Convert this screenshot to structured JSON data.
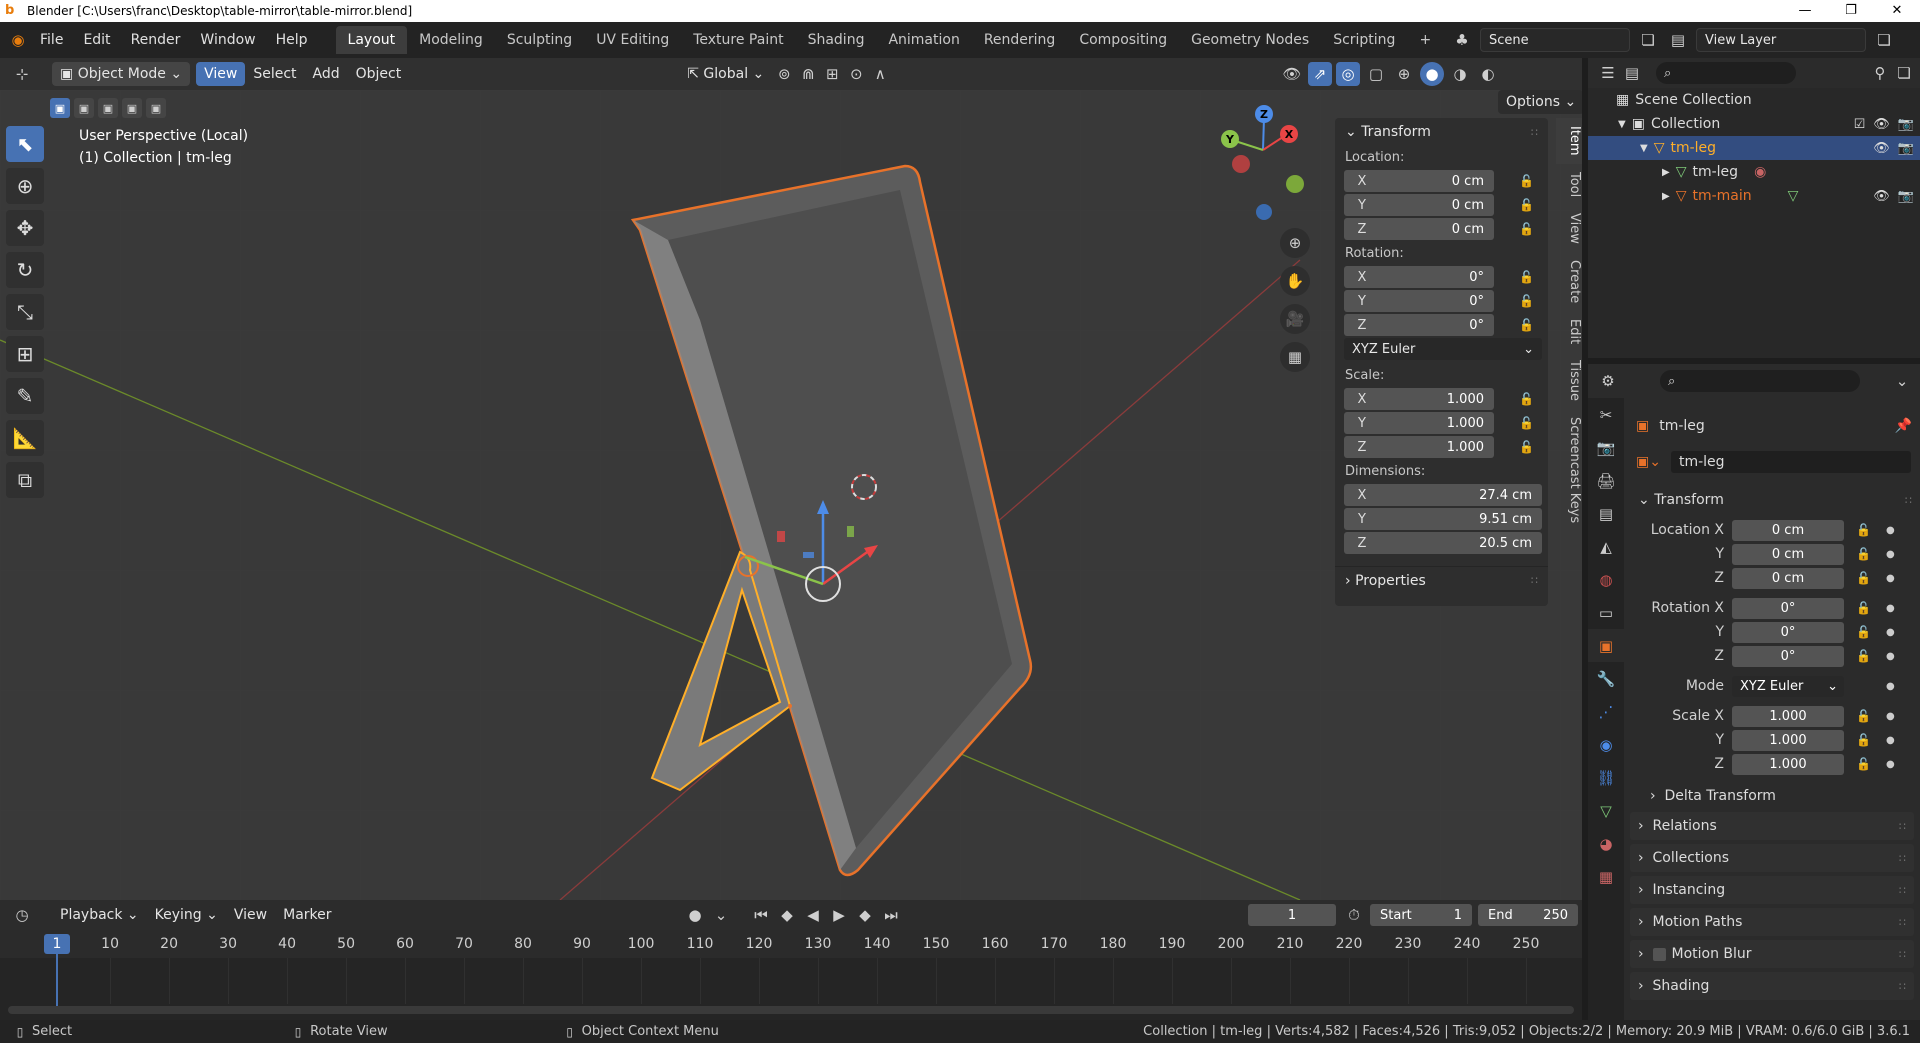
{
  "titlebar": {
    "title": "Blender [C:\\Users\\franc\\Desktop\\table-mirror\\table-mirror.blend]",
    "logo": "b",
    "minimize": "—",
    "maximize": "❐",
    "close": "✕"
  },
  "menu": [
    "File",
    "Edit",
    "Render",
    "Window",
    "Help"
  ],
  "workspaces": [
    "Layout",
    "Modeling",
    "Sculpting",
    "UV Editing",
    "Texture Paint",
    "Shading",
    "Animation",
    "Rendering",
    "Compositing",
    "Geometry Nodes",
    "Scripting"
  ],
  "active_workspace": "Layout",
  "add_workspace": "+",
  "scene": {
    "label": "Scene",
    "view_layer": "View Layer"
  },
  "viewport_header": {
    "mode": "Object Mode",
    "view": "View",
    "select": "Select",
    "add": "Add",
    "object": "Object",
    "orientation": "Global",
    "options": "Options"
  },
  "viewport": {
    "perspective": "User Perspective (Local)",
    "collection_info": "(1) Collection | tm-leg"
  },
  "gizmo": {
    "x": "X",
    "y": "Y",
    "z": "Z"
  },
  "npanel": {
    "transform_title": "Transform",
    "location_label": "Location:",
    "location": [
      {
        "axis": "X",
        "value": "0 cm"
      },
      {
        "axis": "Y",
        "value": "0 cm"
      },
      {
        "axis": "Z",
        "value": "0 cm"
      }
    ],
    "rotation_label": "Rotation:",
    "rotation": [
      {
        "axis": "X",
        "value": "0°"
      },
      {
        "axis": "Y",
        "value": "0°"
      },
      {
        "axis": "Z",
        "value": "0°"
      }
    ],
    "rotation_mode": "XYZ Euler",
    "scale_label": "Scale:",
    "scale": [
      {
        "axis": "X",
        "value": "1.000"
      },
      {
        "axis": "Y",
        "value": "1.000"
      },
      {
        "axis": "Z",
        "value": "1.000"
      }
    ],
    "dimensions_label": "Dimensions:",
    "dimensions": [
      {
        "axis": "X",
        "value": "27.4 cm"
      },
      {
        "axis": "Y",
        "value": "9.51 cm"
      },
      {
        "axis": "Z",
        "value": "20.5 cm"
      }
    ],
    "properties_title": "Properties"
  },
  "ntabs": [
    "Item",
    "Tool",
    "View",
    "Create",
    "Edit",
    "Tissue",
    "Screencast Keys"
  ],
  "timeline": {
    "playback": "Playback",
    "keying": "Keying",
    "view": "View",
    "marker": "Marker",
    "current_frame": "1",
    "start_label": "Start",
    "start": "1",
    "end_label": "End",
    "end": "250",
    "ticks": [
      "10",
      "20",
      "30",
      "40",
      "50",
      "60",
      "70",
      "80",
      "90",
      "100",
      "110",
      "120",
      "130",
      "140",
      "150",
      "160",
      "170",
      "180",
      "190",
      "200",
      "210",
      "220",
      "230",
      "240",
      "250"
    ]
  },
  "statusbar": {
    "select": "Select",
    "rotate": "Rotate View",
    "context": "Object Context Menu",
    "info": "Collection | tm-leg | Verts:4,582 | Faces:4,526 | Tris:9,052 | Objects:2/2 | Memory: 20.9 MiB | VRAM: 0.6/6.0 GiB | 3.6.1"
  },
  "outliner": {
    "scene_collection": "Scene Collection",
    "collection": "Collection",
    "items": [
      {
        "name": "tm-leg",
        "level": 2,
        "selected": true
      },
      {
        "name": "tm-leg",
        "level": 3,
        "selected": false
      },
      {
        "name": "tm-main",
        "level": 3,
        "selected": false
      }
    ]
  },
  "properties": {
    "object_name": "tm-leg",
    "datablock": "tm-leg",
    "transform_title": "Transform",
    "location_label": "Location X",
    "location": [
      "0 cm",
      "0 cm",
      "0 cm"
    ],
    "rotation_label": "Rotation X",
    "rotation": [
      "0°",
      "0°",
      "0°"
    ],
    "mode_label": "Mode",
    "mode": "XYZ Euler",
    "scale_label": "Scale X",
    "scale": [
      "1.000",
      "1.000",
      "1.000"
    ],
    "y_label": "Y",
    "z_label": "Z",
    "delta_transform": "Delta Transform",
    "sections": [
      "Relations",
      "Collections",
      "Instancing",
      "Motion Paths",
      "Motion Blur",
      "Shading"
    ]
  },
  "colors": {
    "accent": "#4772b3",
    "selection_orange": "#e8722a",
    "active_highlight": "#ffaf29",
    "outliner_select": "#334d80"
  }
}
